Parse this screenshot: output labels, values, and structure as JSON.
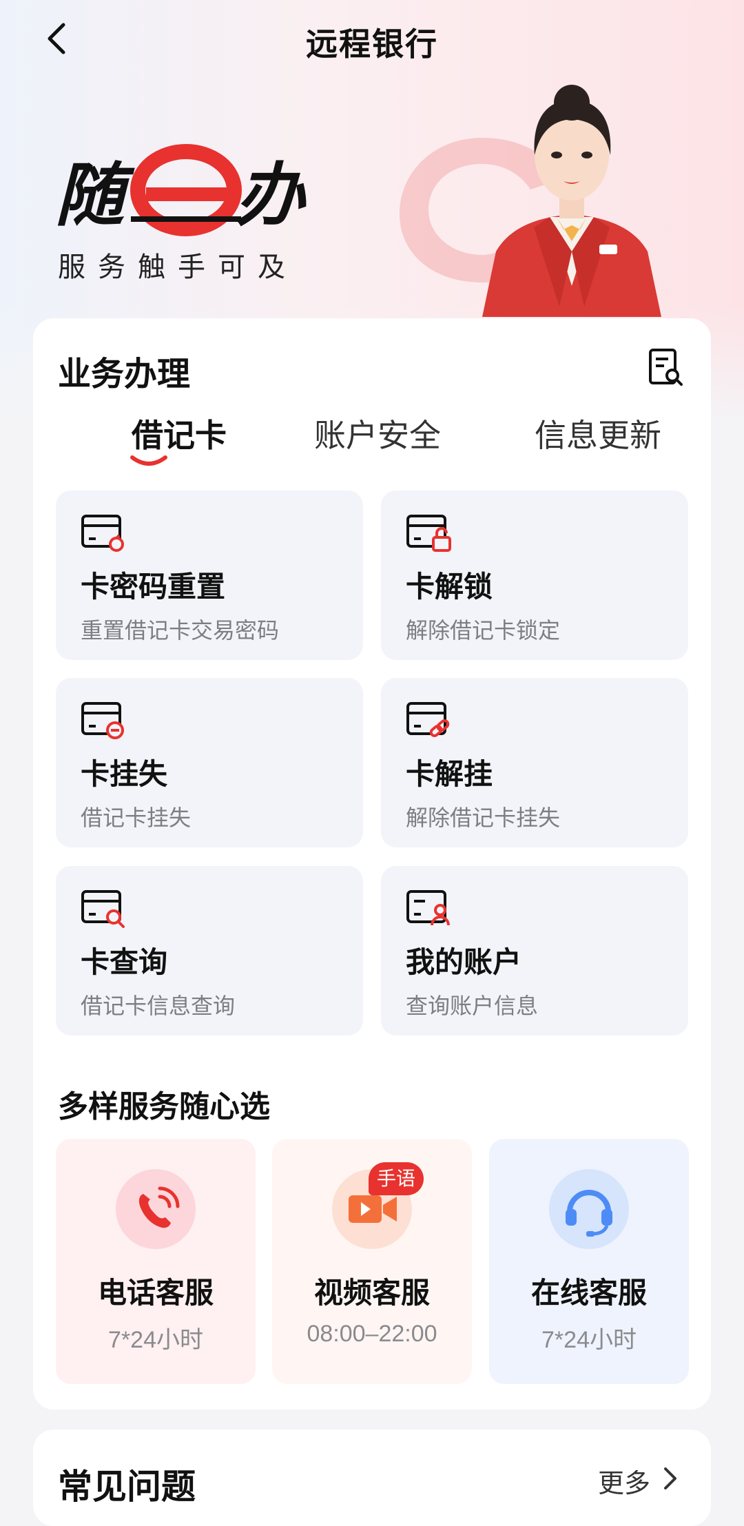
{
  "header": {
    "title": "远程银行"
  },
  "brand": {
    "logo_text": "随e办",
    "slogan": "服务触手可及"
  },
  "business": {
    "title": "业务办理",
    "tabs": [
      {
        "label": "借记卡",
        "active": true
      },
      {
        "label": "账户安全",
        "active": false
      },
      {
        "label": "信息更新",
        "active": false
      }
    ],
    "tiles": [
      {
        "name": "卡密码重置",
        "desc": "重置借记卡交易密码",
        "icon": "card-reset-icon"
      },
      {
        "name": "卡解锁",
        "desc": "解除借记卡锁定",
        "icon": "card-unlock-icon"
      },
      {
        "name": "卡挂失",
        "desc": "借记卡挂失",
        "icon": "card-report-loss-icon"
      },
      {
        "name": "卡解挂",
        "desc": "解除借记卡挂失",
        "icon": "card-unlink-icon"
      },
      {
        "name": "卡查询",
        "desc": "借记卡信息查询",
        "icon": "card-search-icon"
      },
      {
        "name": "我的账户",
        "desc": "查询账户信息",
        "icon": "card-account-icon"
      }
    ]
  },
  "services": {
    "title": "多样服务随心选",
    "items": [
      {
        "name": "电话客服",
        "hours": "7*24小时",
        "icon": "phone-icon"
      },
      {
        "name": "视频客服",
        "hours": "08:00–22:00",
        "badge": "手语",
        "icon": "video-icon"
      },
      {
        "name": "在线客服",
        "hours": "7*24小时",
        "icon": "headset-icon"
      }
    ]
  },
  "faq": {
    "title": "常见问题",
    "more_label": "更多"
  },
  "colors": {
    "accent": "#e8322f",
    "tile_bg": "#f3f4f9",
    "blue": "#4d8cf5",
    "orange": "#f4703a"
  }
}
